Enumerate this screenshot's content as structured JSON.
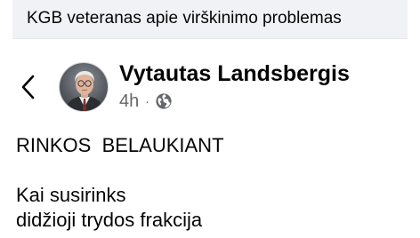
{
  "quoted_post": {
    "title": "KGB veteranas apie virškinimo problemas"
  },
  "header": {
    "back_icon": "chevron-left-icon",
    "author_name": "Vytautas Landsbergis",
    "timestamp": "4h",
    "separator": "·",
    "audience_icon": "globe-icon"
  },
  "post": {
    "line1": "RINKOS  BELAUKIANT",
    "line2": "Kai susirinks",
    "line3": "didžioji trydos frakcija"
  },
  "colors": {
    "quote_bg": "#f0f2f5",
    "text": "#050505",
    "meta": "#65676b"
  }
}
